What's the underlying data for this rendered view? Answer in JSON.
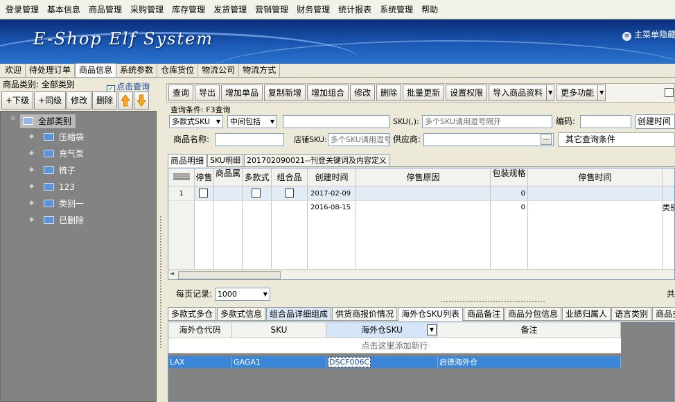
{
  "menubar": [
    "登录管理",
    "基本信息",
    "商品管理",
    "采购管理",
    "库存管理",
    "发货管理",
    "营销管理",
    "财务管理",
    "统计报表",
    "系统管理",
    "帮助"
  ],
  "banner": {
    "logo": "E-Shop Elf System",
    "hide_menu": "主菜单隐藏"
  },
  "tabs": [
    "欢迎",
    "待处理订单",
    "商品信息",
    "系统参数",
    "仓库货位",
    "物流公司",
    "物流方式"
  ],
  "active_tab": "商品信息",
  "left": {
    "category_label": "商品类别: 全部类别",
    "click_query": "点击查询",
    "buttons": [
      "+下级",
      "+同级",
      "修改",
      "删除"
    ],
    "tree_root": "全部类别",
    "tree_items": [
      "压缩袋",
      "充气泵",
      "梳子",
      "123",
      "类别一",
      "已删除"
    ]
  },
  "toolbar": {
    "buttons": [
      "查询",
      "导出",
      "增加单品",
      "复制新增",
      "增加组合",
      "修改",
      "删除",
      "批量更新",
      "设置权限",
      "导入商品资料",
      "更多功能"
    ]
  },
  "query": {
    "condition_label": "查询条件: F3查询",
    "type_select": "多款式SKU",
    "match_select": "中间包括",
    "sku_label": "SKU(,):",
    "sku_placeholder": "多个SKU请用逗号隔开",
    "code_label": "编码:",
    "created_label": "创建时间",
    "name_label": "商品名称:",
    "store_sku_label": "店铺SKU:",
    "store_sku_placeholder": "多个SKU请用逗号",
    "supplier_label": "供应商:",
    "other_conditions": "其它查询条件"
  },
  "product_tabs": [
    "商品明细",
    "SKU明细",
    "201702090021--刊登关键词及内容定义"
  ],
  "grid1": {
    "headers": [
      "停售",
      "商品属",
      "多款式",
      "组合品",
      "创建时间",
      "停售原因",
      "包装规格",
      "停售时间"
    ],
    "rows": [
      {
        "num": "1",
        "created": "2017-02-09",
        "packing": "0",
        "extra": ""
      },
      {
        "num": "",
        "created": "2016-08-15",
        "packing": "0",
        "extra": "类别"
      }
    ]
  },
  "pager": {
    "label": "每页记录:",
    "value": "1000",
    "total_label": "共"
  },
  "bottom_tabs": [
    "多款式多仓",
    "多款式信息",
    "组合品详细组成",
    "供货商报价情况",
    "海外仓SKU列表",
    "商品备注",
    "商品分包信息",
    "业绩归属人",
    "语言类别",
    "商品多"
  ],
  "bottom_active": "海外仓SKU列表",
  "grid2": {
    "headers": [
      "海外仓代码",
      "SKU",
      "海外仓SKU",
      "备注"
    ],
    "add_row": "点击这里添加新行",
    "rows": [
      {
        "code": "LAX",
        "sku": "GAGA1",
        "overseas_sku": "DSCF006C",
        "note": "启德海外仓"
      }
    ]
  }
}
